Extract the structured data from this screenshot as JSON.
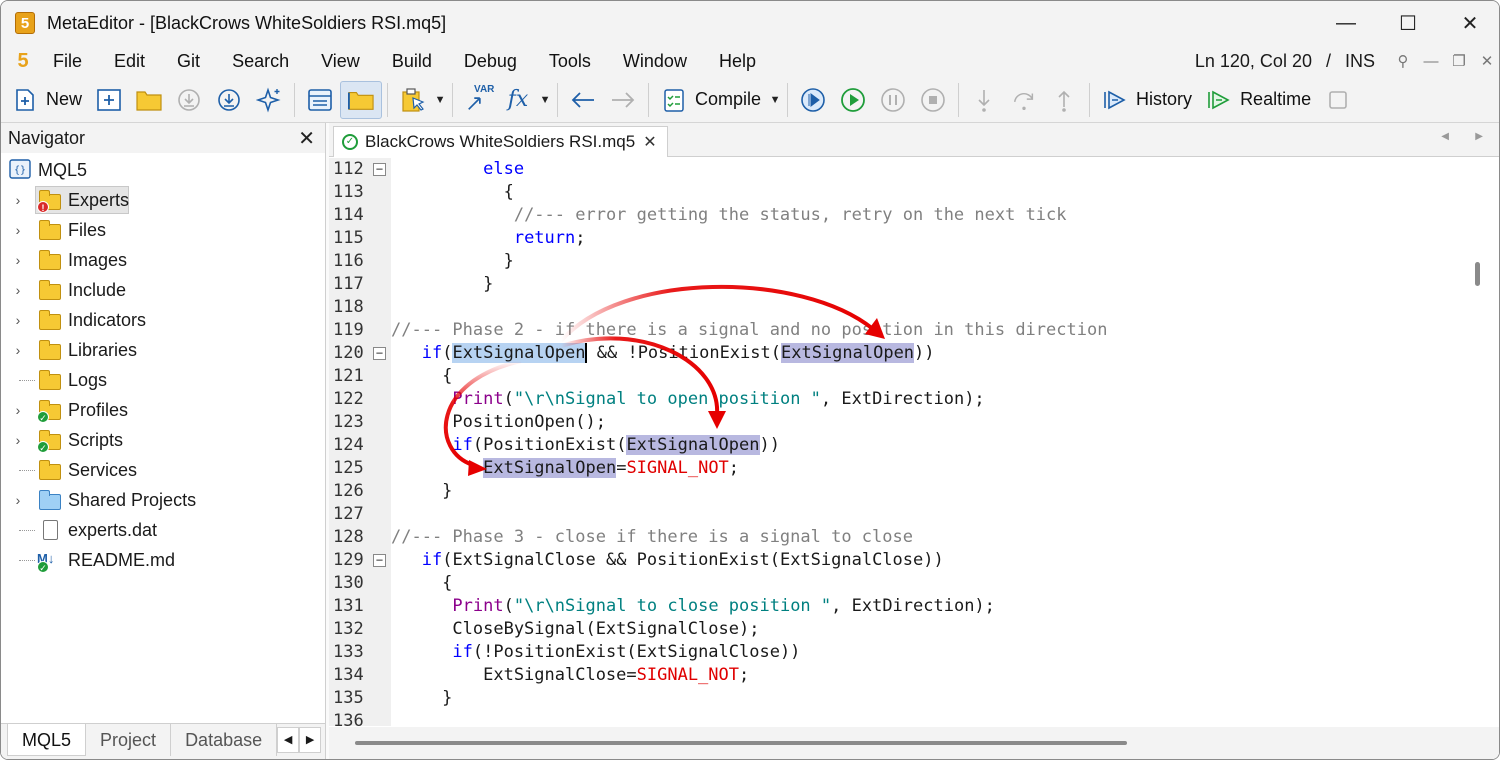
{
  "window": {
    "app_title": "MetaEditor - [BlackCrows WhiteSoldiers RSI.mq5]",
    "logo_text": "5",
    "minimize": "—",
    "maximize": "☐",
    "close": "✕"
  },
  "menu": {
    "logo": "5",
    "items": [
      "File",
      "Edit",
      "Git",
      "Search",
      "View",
      "Build",
      "Debug",
      "Tools",
      "Window",
      "Help"
    ],
    "cursor_position": "Ln 120, Col 20",
    "separator": "/",
    "insert_mode": "INS"
  },
  "toolbar": {
    "new_label": "New",
    "compile_label": "Compile",
    "history_label": "History",
    "realtime_label": "Realtime",
    "var_label": "VAR",
    "fx_label": "fx"
  },
  "navigator": {
    "title": "Navigator",
    "root": "MQL5",
    "items": [
      {
        "label": "Experts",
        "expandable": true,
        "icon": "folder",
        "badge": "error",
        "selected": true
      },
      {
        "label": "Files",
        "expandable": true,
        "icon": "folder"
      },
      {
        "label": "Images",
        "expandable": true,
        "icon": "folder"
      },
      {
        "label": "Include",
        "expandable": true,
        "icon": "folder"
      },
      {
        "label": "Indicators",
        "expandable": true,
        "icon": "folder"
      },
      {
        "label": "Libraries",
        "expandable": true,
        "icon": "folder"
      },
      {
        "label": "Logs",
        "expandable": false,
        "icon": "folder"
      },
      {
        "label": "Profiles",
        "expandable": true,
        "icon": "folder",
        "badge": "ok"
      },
      {
        "label": "Scripts",
        "expandable": true,
        "icon": "folder",
        "badge": "ok"
      },
      {
        "label": "Services",
        "expandable": false,
        "icon": "folder"
      },
      {
        "label": "Shared Projects",
        "expandable": true,
        "icon": "folder-blue"
      },
      {
        "label": "experts.dat",
        "expandable": false,
        "icon": "file"
      },
      {
        "label": "README.md",
        "expandable": false,
        "icon": "markdown",
        "badge": "ok"
      }
    ],
    "tabs": [
      "MQL5",
      "Project",
      "Database"
    ]
  },
  "editor": {
    "tab_title": "BlackCrows WhiteSoldiers RSI.mq5",
    "lines": [
      {
        "num": "112",
        "fold": true,
        "html": "         <span class='kw'>else</span>"
      },
      {
        "num": "113",
        "html": "           {"
      },
      {
        "num": "114",
        "html": "            <span class='cm'>//--- error getting the status, retry on the next tick</span>"
      },
      {
        "num": "115",
        "html": "            <span class='kw'>return</span>;"
      },
      {
        "num": "116",
        "html": "           }"
      },
      {
        "num": "117",
        "html": "         }"
      },
      {
        "num": "118",
        "html": ""
      },
      {
        "num": "119",
        "html": "<span class='cm'>//--- Phase 2 - if there is a signal and no position in this direction</span>"
      },
      {
        "num": "120",
        "fold": true,
        "html": "   <span class='kw'>if</span>(<span class='hl-sel'>ExtSignalOpen</span>| &amp;&amp; !PositionExist(<span class='hl'>ExtSignalOpen</span>))"
      },
      {
        "num": "121",
        "html": "     {"
      },
      {
        "num": "122",
        "html": "      <span class='fn'>Print</span>(<span class='str'>\"\\r\\nSignal to open position \"</span>, ExtDirection);"
      },
      {
        "num": "123",
        "html": "      PositionOpen();"
      },
      {
        "num": "124",
        "html": "      <span class='kw'>if</span>(PositionExist(<span class='hl'>ExtSignalOpen</span>))"
      },
      {
        "num": "125",
        "html": "         <span class='hl'>ExtSignalOpen</span>=<span class='red'>SIGNAL_NOT</span>;"
      },
      {
        "num": "126",
        "html": "     }"
      },
      {
        "num": "127",
        "html": ""
      },
      {
        "num": "128",
        "html": "<span class='cm'>//--- Phase 3 - close if there is a signal to close</span>"
      },
      {
        "num": "129",
        "fold": true,
        "html": "   <span class='kw'>if</span>(ExtSignalClose &amp;&amp; PositionExist(ExtSignalClose))"
      },
      {
        "num": "130",
        "html": "     {"
      },
      {
        "num": "131",
        "html": "      <span class='fn'>Print</span>(<span class='str'>\"\\r\\nSignal to close position \"</span>, ExtDirection);"
      },
      {
        "num": "132",
        "html": "      CloseBySignal(ExtSignalClose);"
      },
      {
        "num": "133",
        "html": "      <span class='kw'>if</span>(!PositionExist(ExtSignalClose))"
      },
      {
        "num": "134",
        "html": "         ExtSignalClose=<span class='red'>SIGNAL_NOT</span>;"
      },
      {
        "num": "135",
        "html": "     }"
      },
      {
        "num": "136",
        "html": ""
      }
    ]
  },
  "colors": {
    "keyword": "#0000ff",
    "comment": "#808080",
    "function": "#8b008b",
    "string": "#008080",
    "constant": "#e00000",
    "highlight": "#b8b8e0",
    "arrow": "#e60000"
  }
}
